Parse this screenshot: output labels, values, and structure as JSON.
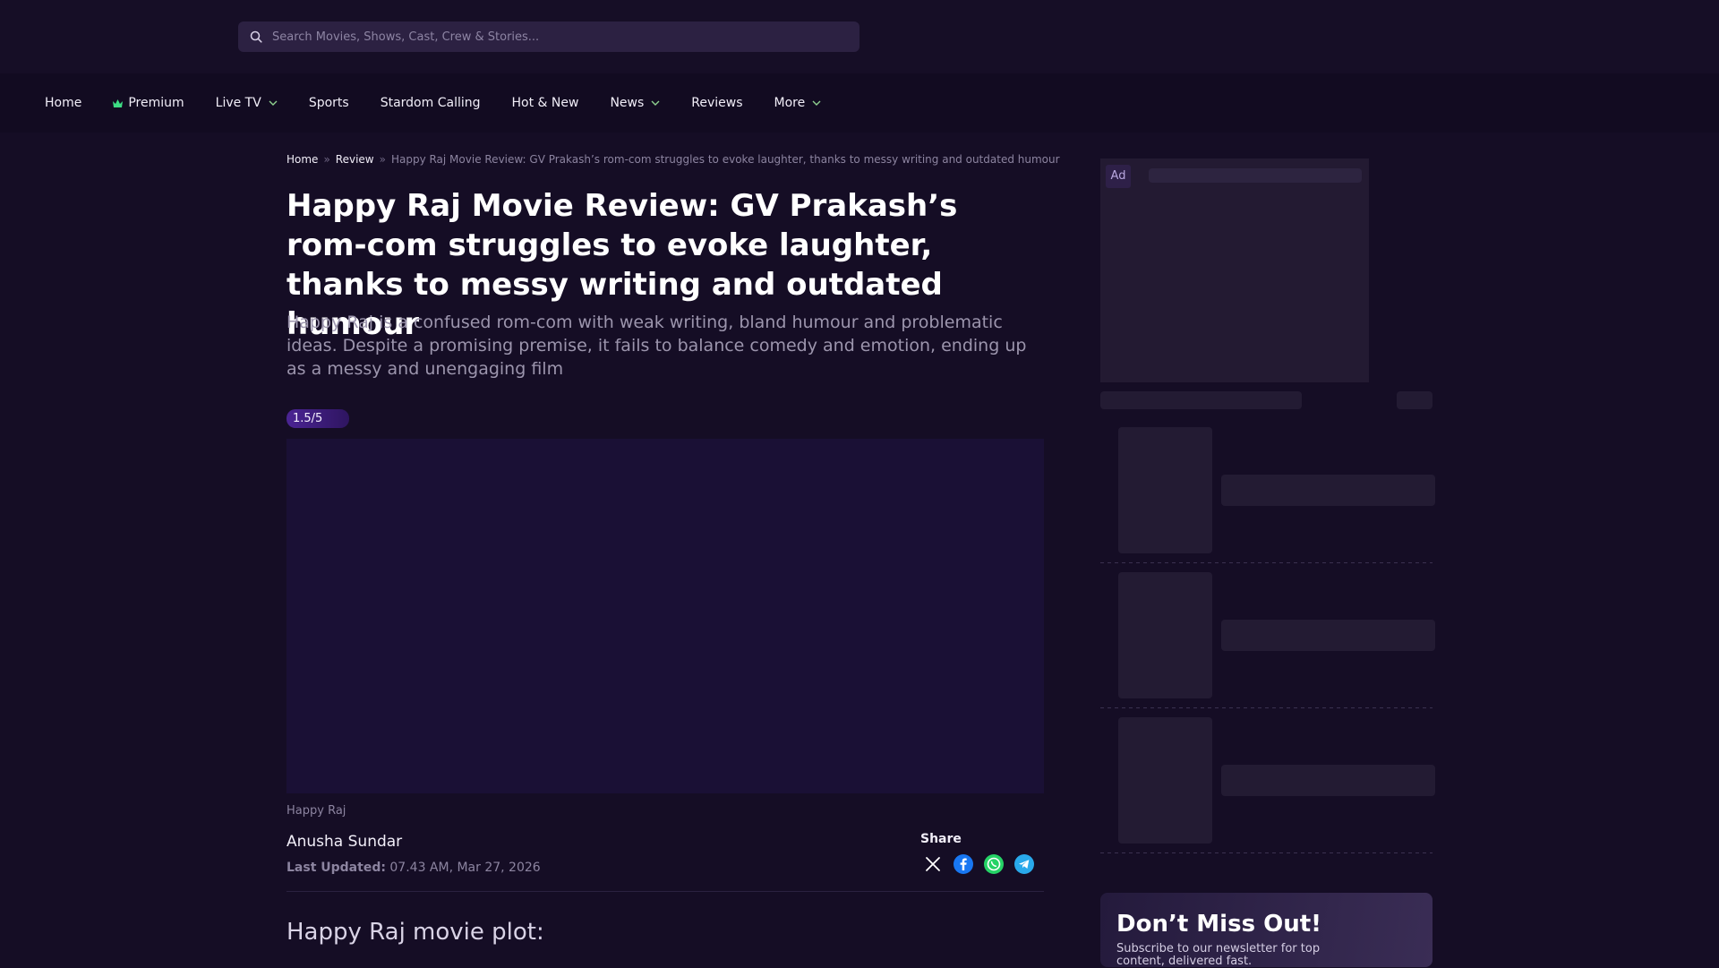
{
  "search": {
    "placeholder": "Search Movies, Shows, Cast, Crew & Stories..."
  },
  "nav": {
    "items": [
      {
        "label": "Home"
      },
      {
        "label": "Premium",
        "icon": "crown-icon"
      },
      {
        "label": "Live TV",
        "dropdown": true
      },
      {
        "label": "Sports"
      },
      {
        "label": "Stardom Calling"
      },
      {
        "label": "Hot & New"
      },
      {
        "label": "News",
        "dropdown": true
      },
      {
        "label": "Reviews"
      },
      {
        "label": "More",
        "dropdown": true
      }
    ]
  },
  "breadcrumb": {
    "home": "Home",
    "review": "Review",
    "current": "Happy Raj Movie Review: GV Prakash’s rom-com struggles to evoke laughter, thanks to messy writing and outdated humour",
    "separator": "»"
  },
  "article": {
    "title": "Happy Raj Movie Review: GV Prakash’s rom-com struggles to evoke laughter, thanks to messy writing and outdated humour",
    "summary": "Happy Raj is a confused rom-com with weak writing, bland humour and problematic ideas. Despite a promising premise, it fails to balance comedy and emotion, ending up as a messy and unengaging film",
    "rating": "1.5/5",
    "caption": "Happy Raj",
    "author": "Anusha Sundar",
    "updated_label": "Last Updated:",
    "updated_value": "07.43 AM, Mar 27, 2026",
    "share_label": "Share",
    "section_heading": "Happy Raj movie plot:"
  },
  "sidebar": {
    "ad_label": "Ad",
    "promo_title": "Don’t Miss Out!",
    "promo_text": "Subscribe to our newsletter for top content, delivered fast."
  },
  "colors": {
    "background": "#150d25",
    "accent": "#4b2494",
    "premium_crown": "#3ddc84"
  }
}
